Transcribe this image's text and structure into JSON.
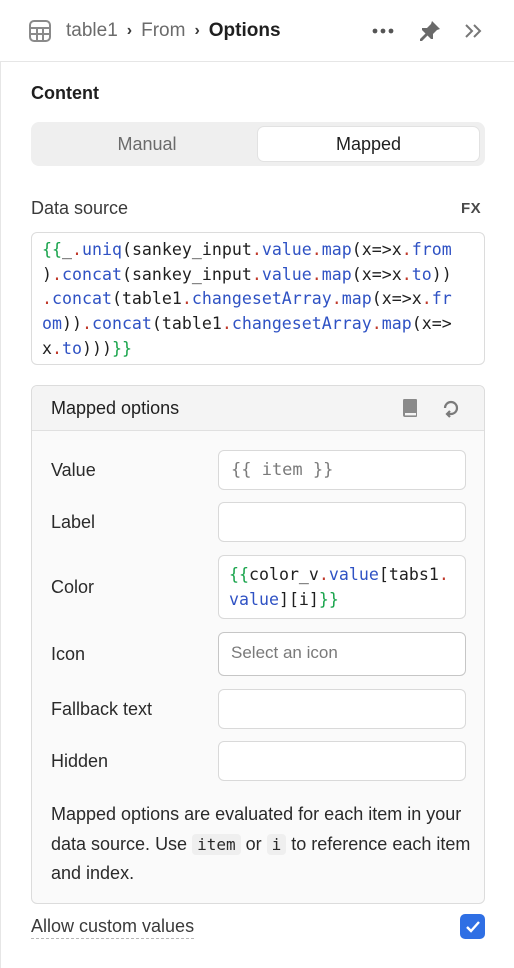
{
  "breadcrumb": [
    "table1",
    "From",
    "Options"
  ],
  "header": {
    "grid_icon": "grid-icon",
    "more_icon": "more-dots-icon",
    "pin_icon": "pin-icon",
    "collapse_icon": "double-chevron-right-icon"
  },
  "content": {
    "title": "Content",
    "segment": {
      "manual": "Manual",
      "mapped": "Mapped",
      "selected": "Mapped"
    }
  },
  "data_source": {
    "label": "Data source",
    "fx_label": "FX",
    "code_lines": [
      "{{_.uniq(sankey_input.value.map(x=>x.from",
      ").concat(sankey_input.value.map(x=>x.to))",
      ".concat(table1.changesetArray.map(x=>x.fr",
      "om)).concat(table1.changesetArray.map(x=>",
      "x.to)))}}"
    ]
  },
  "mapped_options": {
    "title": "Mapped options",
    "doc_icon": "book-icon",
    "reset_icon": "reset-icon",
    "value": {
      "label": "Value",
      "placeholder": "{{ item }}"
    },
    "label_field": {
      "label": "Label",
      "value": ""
    },
    "color": {
      "label": "Color",
      "code_lines": [
        "{{color_v.value[tabs1.",
        "value][i]}}"
      ]
    },
    "icon": {
      "label": "Icon",
      "placeholder": "Select an icon"
    },
    "fallback_text": {
      "label": "Fallback text",
      "value": ""
    },
    "hidden": {
      "label": "Hidden",
      "value": ""
    },
    "help": {
      "part1": "Mapped options are evaluated for each item in your data source. Use ",
      "chip1": "item",
      "part2": " or ",
      "chip2": "i",
      "part3": " to reference each item and index."
    }
  },
  "allow_custom": {
    "label": "Allow custom values",
    "checked": true
  },
  "colors": {
    "accent": "#2f6fe4",
    "code_brace": "#17a34a",
    "code_fn": "#2f52c4",
    "code_dot": "#c0392b"
  }
}
